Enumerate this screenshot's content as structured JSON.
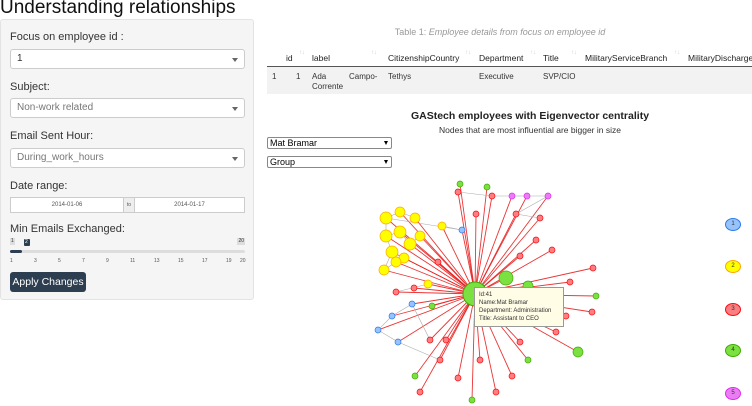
{
  "title": "Understanding relationships",
  "sidebar": {
    "focus_label": "Focus on employee id :",
    "focus_value": "1",
    "subject_label": "Subject:",
    "subject_value": "Non-work related",
    "hour_label": "Email Sent Hour:",
    "hour_value": "During_work_hours",
    "date_label": "Date range:",
    "date_start": "2014-01-06",
    "date_to": "to",
    "date_end": "2014-01-17",
    "min_label": "Min Emails Exchanged:",
    "slider": {
      "min": "1",
      "max": "20",
      "value": "2",
      "value_fraction": 0.053,
      "ticks": [
        "1",
        "3",
        "5",
        "7",
        "9",
        "11",
        "13",
        "15",
        "17",
        "19",
        "20"
      ]
    },
    "apply_label": "Apply Changes"
  },
  "table": {
    "caption_prefix": "Table 1: ",
    "caption_text": "Employee details from focus on employee id",
    "columns": [
      "id",
      "label",
      "CitizenshipCountry",
      "Department",
      "Title",
      "MilitaryServiceBranch",
      "MilitaryDischarge"
    ],
    "row": {
      "index": "1",
      "id": "1",
      "label_1": "Ada",
      "label_2": "Campo-",
      "label_3": "Corrente",
      "country": "Tethys",
      "department": "Executive",
      "title": "SVP/CIO"
    }
  },
  "chart": {
    "title": "GAStech employees with Eigenvector centrality",
    "subtitle": "Nodes that are most influential are bigger in size",
    "select_node": "Mat Bramar",
    "select_group": "Group",
    "tooltip": {
      "id": "Id:41",
      "name": "Name:Mat Bramar",
      "department": "Department: Administration",
      "title": "Title: Assistant to CEO"
    },
    "legend": [
      {
        "label": "1",
        "color": "#97c2fc",
        "border": "#2b7ce9"
      },
      {
        "label": "2",
        "color": "#ffff00",
        "border": "#ffa500"
      },
      {
        "label": "3",
        "color": "#fb7e81",
        "border": "#fa0a10"
      },
      {
        "label": "4",
        "color": "#7be141",
        "border": "#41a906"
      },
      {
        "label": "5",
        "color": "#eb7df4",
        "border": "#e129f0"
      }
    ]
  }
}
